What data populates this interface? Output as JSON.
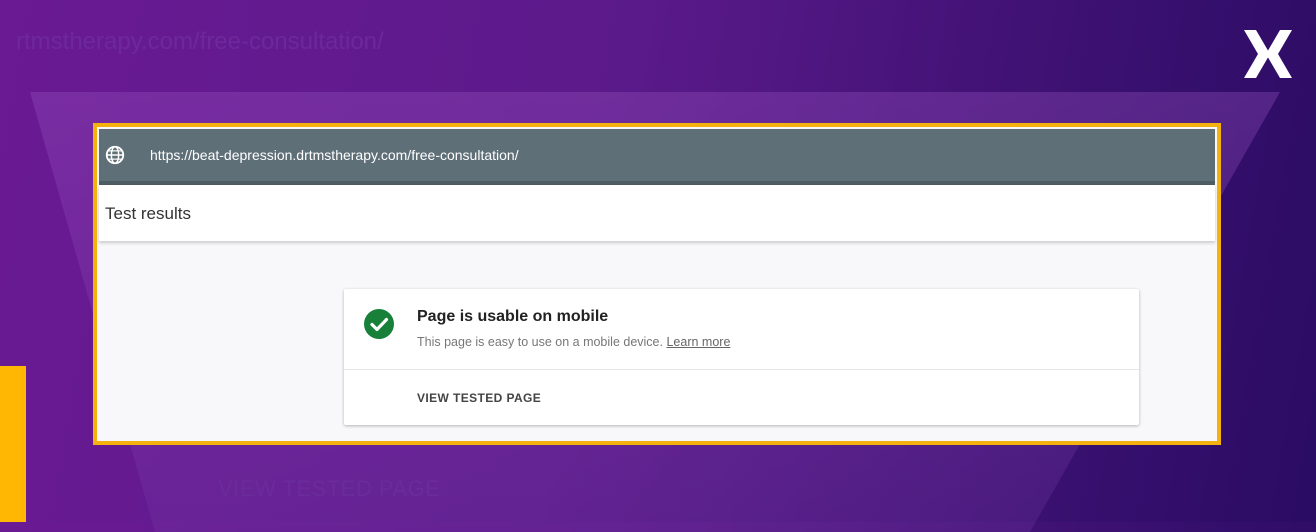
{
  "background": {
    "ghost_url": "rtmstherapy.com/free-consultation/",
    "ghost_button": "VIEW TESTED PAGE"
  },
  "brand": {
    "logo": "x-logo-icon"
  },
  "browser": {
    "url": "https://beat-depression.drtmstherapy.com/free-consultation/",
    "icon": "globe-icon"
  },
  "header": {
    "title": "Test results"
  },
  "result_card": {
    "icon": "check-circle-icon",
    "status_color": "#188038",
    "title": "Page is usable on mobile",
    "description": "This page is easy to use on a mobile device.",
    "learn_more": "Learn more",
    "button": "VIEW TESTED PAGE"
  },
  "colors": {
    "accent": "#f5b20e",
    "url_bar": "#5f6f78"
  }
}
